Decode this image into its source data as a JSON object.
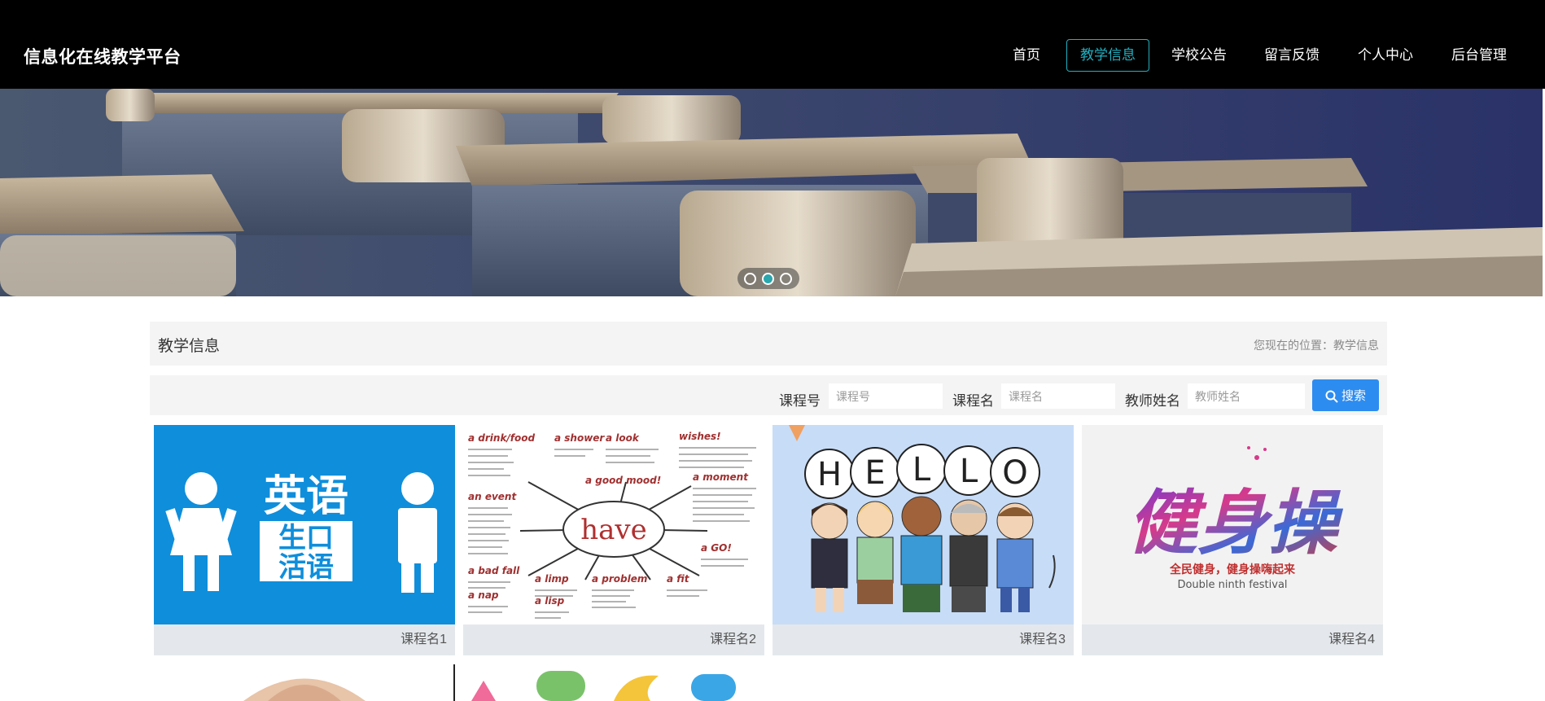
{
  "header": {
    "brand": "信息化在线教学平台",
    "nav": [
      "首页",
      "教学信息",
      "学校公告",
      "留言反馈",
      "个人中心",
      "后台管理"
    ],
    "active_index": 1,
    "accent_color": "#21b0c1"
  },
  "banner": {
    "slide_count": 3,
    "active_slide": 1
  },
  "title_bar": {
    "title": "教学信息",
    "location": "您现在的位置：教学信息"
  },
  "search": {
    "course_no_label": "课程号",
    "course_no_placeholder": "课程号",
    "course_name_label": "课程名",
    "course_name_placeholder": "课程名",
    "teacher_label": "教师姓名",
    "teacher_placeholder": "教师姓名",
    "button_label": "搜索",
    "button_color": "#2d8cf0"
  },
  "courses": [
    {
      "caption": "课程名1",
      "image_text": [
        "英语",
        "生口",
        "活语"
      ]
    },
    {
      "caption": "课程名2",
      "image_text": [
        "have",
        "a drink/food",
        "a shower",
        "a look",
        "wishes!",
        "a good mood!",
        "an event",
        "a moment",
        "a bad fall",
        "a limp",
        "a problem",
        "a fit",
        "a nap",
        "a lisp",
        "a GO!"
      ]
    },
    {
      "caption": "课程名3",
      "image_text": [
        "H",
        "E",
        "L",
        "L",
        "O"
      ]
    },
    {
      "caption": "课程名4",
      "image_text": [
        "健身操",
        "全民健身，健身操嗨起来",
        "Double ninth festival"
      ]
    }
  ]
}
